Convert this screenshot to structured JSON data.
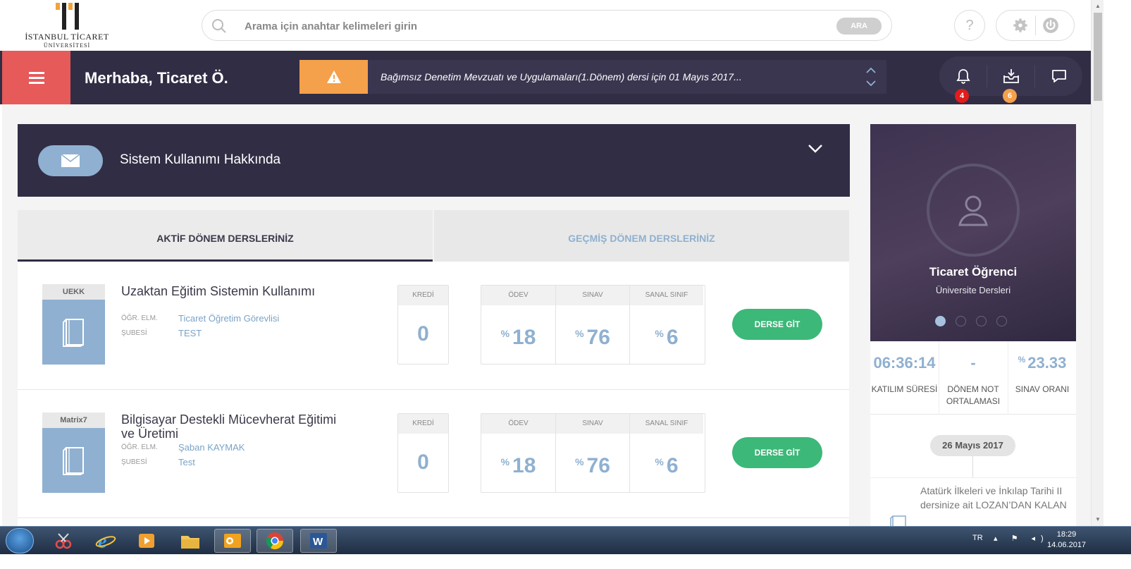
{
  "logo": {
    "line1": "İSTANBUL TİCARET",
    "line2": "ÜNİVERSİTESİ"
  },
  "search": {
    "placeholder": "Arama için anahtar kelimeleri girin",
    "button": "ARA"
  },
  "header": {
    "help": "?"
  },
  "nav": {
    "greeting": "Merhaba, Ticaret Ö.",
    "alert_text": "Bağımsız Denetim Mevzuatı ve Uygulamaları(1.Dönem) dersi için 01 Mayıs 2017...",
    "notifications_count": "4",
    "inbox_count": "6",
    "colors": {
      "dark": "#312d45",
      "menu": "#e65a5a",
      "alert": "#f5a04a",
      "badge_red": "#e21b1b",
      "badge_orange": "#f5a04a"
    }
  },
  "announcement": {
    "title": "Sistem Kullanımı Hakkında"
  },
  "tabs": [
    {
      "label": "AKTİF DÖNEM DERSLERİNİZ"
    },
    {
      "label": "GEÇMİŞ DÖNEM DERSLERİNİZ"
    }
  ],
  "course_labels": {
    "teacher": "ÖĞR. ELM.",
    "branch": "ŞUBESİ",
    "credit": "KREDİ",
    "homework": "ÖDEV",
    "exam": "SINAV",
    "virtual_class": "SANAL SINIF",
    "go_button": "DERSE GİT",
    "percent": "%"
  },
  "courses": [
    {
      "code": "UEKK",
      "name": "Uzaktan Eğitim Sistemin Kullanımı",
      "teacher": "Ticaret Öğretim Görevlisi",
      "branch": "TEST",
      "credit": "0",
      "homework": "18",
      "exam": "76",
      "virtual_class": "6"
    },
    {
      "code": "Matrix7",
      "name": "Bilgisayar Destekli Mücevherat Eğitimi ve Üretimi",
      "teacher": "Şaban KAYMAK",
      "branch": "Test",
      "credit": "0",
      "homework": "18",
      "exam": "76",
      "virtual_class": "6"
    }
  ],
  "profile": {
    "name": "Ticaret Öğrenci",
    "subtitle": "Üniversite Dersleri"
  },
  "metrics": [
    {
      "value": "06:36:14",
      "label": "KATILIM SÜRESİ"
    },
    {
      "value": "-",
      "label": "DÖNEM NOT ORTALAMASI"
    },
    {
      "value": "23.33",
      "prefix": "%",
      "label": "SINAV ORANI"
    }
  ],
  "timeline": {
    "date": "26 Mayıs 2017",
    "entry": "Atatürk İlkeleri ve İnkılap Tarihi II dersinize ait LOZAN’DAN KALAN"
  },
  "taskbar": {
    "lang": "TR",
    "time": "18:29",
    "date": "14.06.2017"
  }
}
